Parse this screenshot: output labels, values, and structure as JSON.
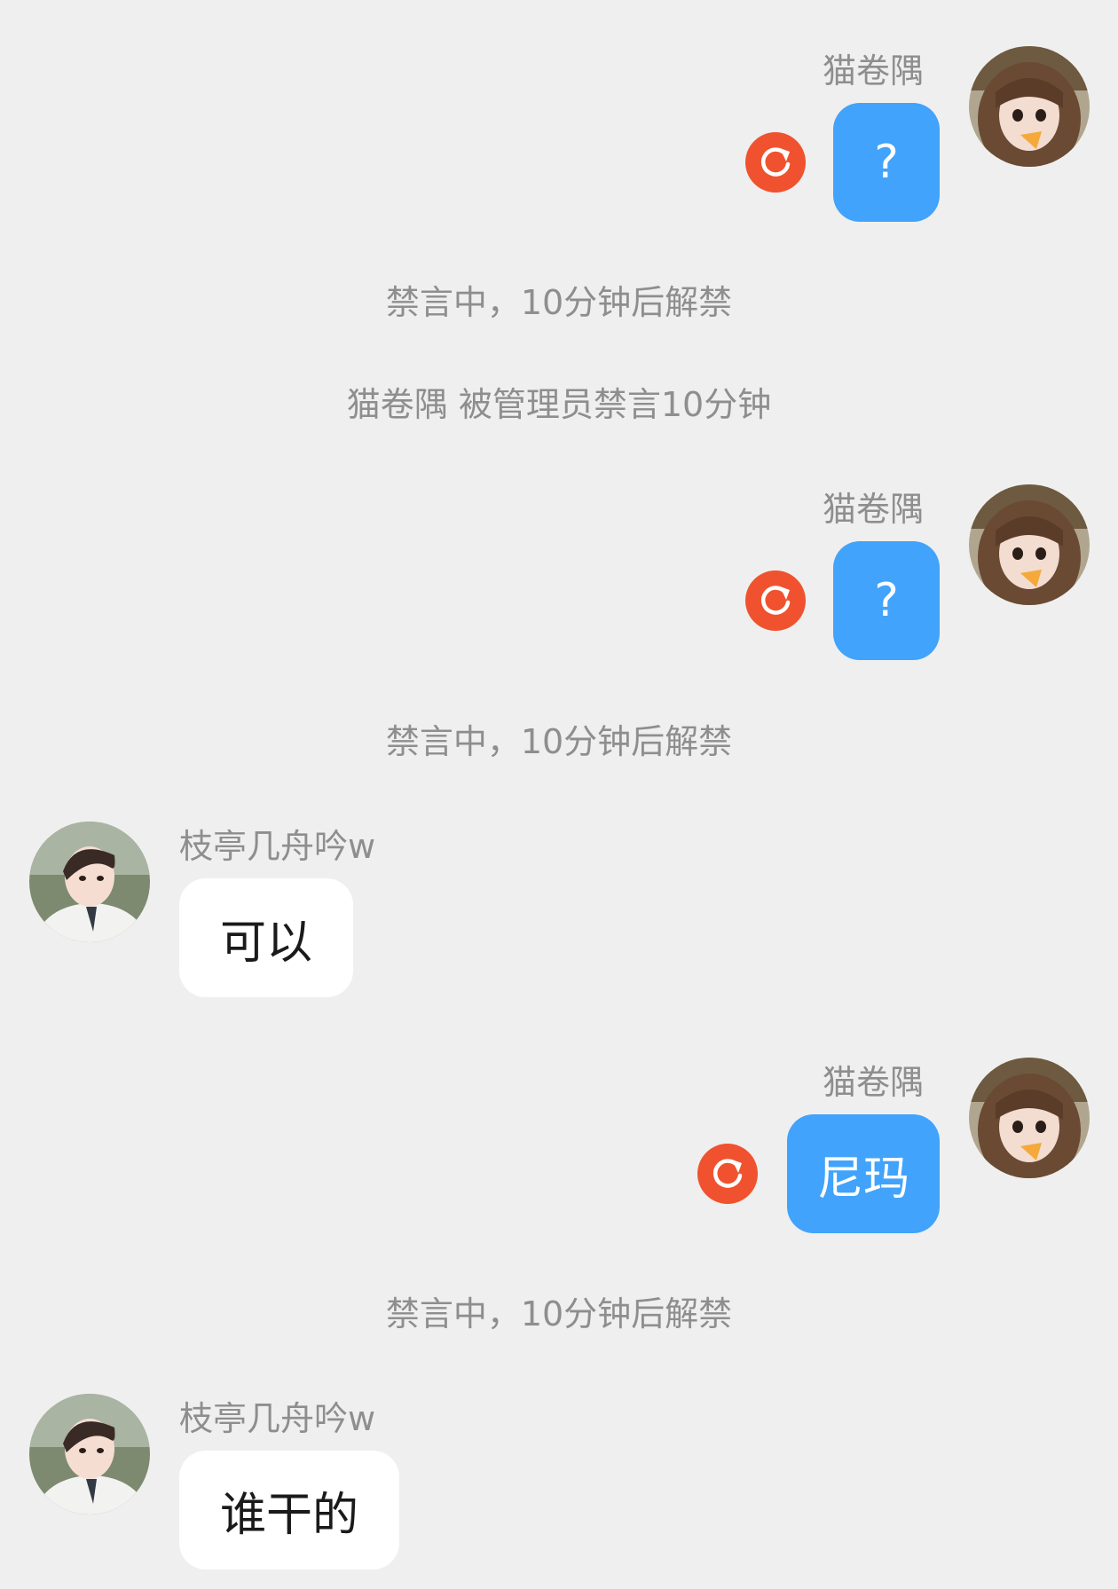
{
  "messages": [
    {
      "kind": "outgoing",
      "sender": "猫卷隅",
      "text": "?",
      "avatar": "female-avatar",
      "status": "failed",
      "status_icon": "resend-icon"
    },
    {
      "kind": "system",
      "text": "禁言中，10分钟后解禁"
    },
    {
      "kind": "system",
      "text": "猫卷隅 被管理员禁言10分钟"
    },
    {
      "kind": "outgoing",
      "sender": "猫卷隅",
      "text": "?",
      "avatar": "female-avatar",
      "status": "failed",
      "status_icon": "resend-icon"
    },
    {
      "kind": "system",
      "text": "禁言中，10分钟后解禁"
    },
    {
      "kind": "incoming",
      "sender": "枝亭几舟吟w",
      "text": "可以",
      "avatar": "male-avatar"
    },
    {
      "kind": "outgoing",
      "sender": "猫卷隅",
      "text": "尼玛",
      "avatar": "female-avatar",
      "status": "failed",
      "status_icon": "resend-icon"
    },
    {
      "kind": "system",
      "text": "禁言中，10分钟后解禁"
    },
    {
      "kind": "incoming",
      "sender": "枝亭几舟吟w",
      "text": "谁干的",
      "avatar": "male-avatar"
    }
  ],
  "colors": {
    "background": "#efefef",
    "outgoing_bubble": "#41a3fb",
    "incoming_bubble": "#ffffff",
    "resend_badge": "#f0522f",
    "meta_text": "#8e8e8e"
  }
}
